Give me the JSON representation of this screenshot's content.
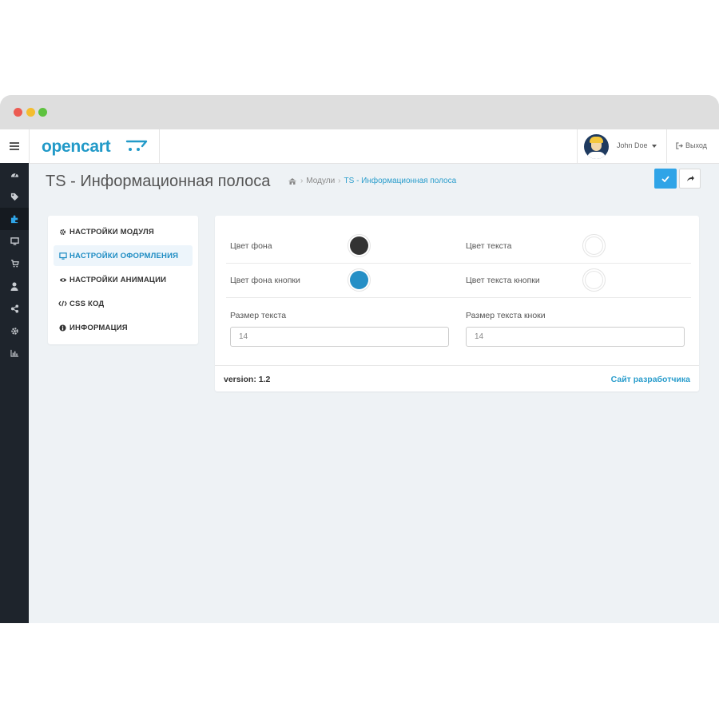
{
  "window": {
    "title_dots": [
      "close",
      "minimize",
      "maximize"
    ]
  },
  "topbar": {
    "logo_text": "opencart",
    "user_name": "John Doe",
    "logout_label": "Выход"
  },
  "sidebar": {
    "icons": [
      "dashboard-icon",
      "tags-icon",
      "puzzle-icon",
      "desktop-icon",
      "cart-icon",
      "user-icon",
      "share-icon",
      "cog-icon",
      "bar-chart-icon"
    ],
    "active_index": 2
  },
  "header": {
    "title": "TS - Информационная полоса",
    "breadcrumbs": [
      "Модули",
      "TS - Информационная полоса"
    ]
  },
  "nav": {
    "items": [
      {
        "label": "НАСТРОЙКИ МОДУЛЯ",
        "icon": "cog-icon"
      },
      {
        "label": "НАСТРОЙКИ ОФОРМЛЕНИЯ",
        "icon": "desktop-icon",
        "active": true
      },
      {
        "label": "НАСТРОЙКИ АНИМАЦИИ",
        "icon": "eye-icon"
      },
      {
        "label": "CSS КОД",
        "icon": "code-icon"
      },
      {
        "label": "ИНФОРМАЦИЯ",
        "icon": "info-icon"
      }
    ]
  },
  "form": {
    "bg_color_label": "Цвет фона",
    "bg_color": "#333333",
    "text_color_label": "Цвет текста",
    "text_color": "#ffffff",
    "btn_bg_color_label": "Цвет фона кнопки",
    "btn_bg_color": "#258fc6",
    "btn_text_color_label": "Цвет текста кнопки",
    "btn_text_color": "#ffffff",
    "text_size_label": "Размер текста",
    "text_size_value": "14",
    "btn_text_size_label": "Размер текста кноки",
    "btn_text_size_value": "14"
  },
  "footer": {
    "version": "version: 1.2",
    "dev_link": "Сайт разработчика"
  },
  "colors": {
    "accent": "#2fa4e7",
    "sidebar": "#1e242c",
    "link": "#2a9dcc"
  }
}
